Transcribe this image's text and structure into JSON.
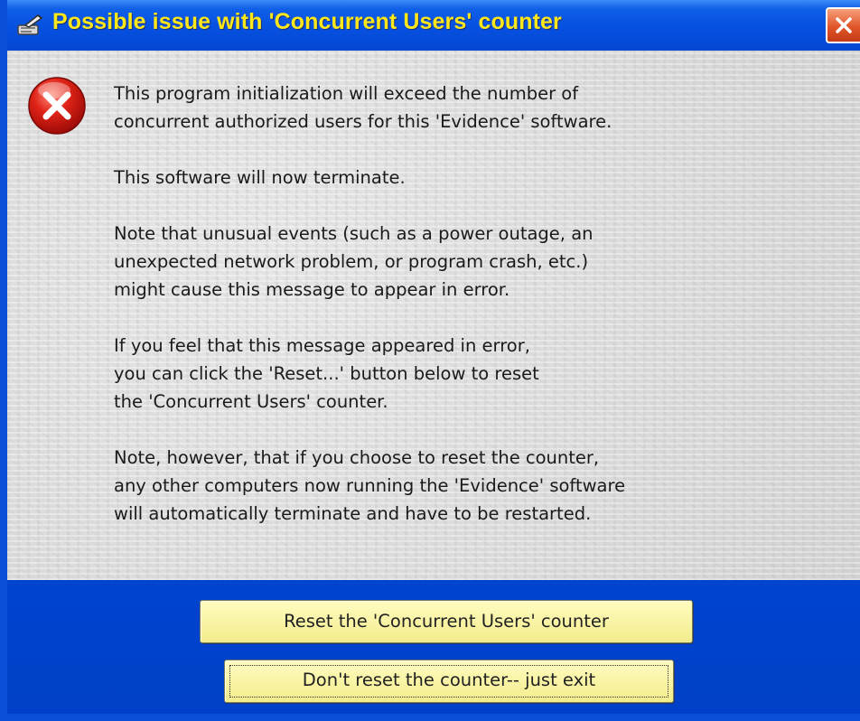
{
  "window": {
    "title": "Possible issue with 'Concurrent Users' counter",
    "title_icon": "gear-pen-icon",
    "close_icon": "close-icon"
  },
  "dialog": {
    "icon": "error-icon",
    "paragraphs": [
      "This program initialization will exceed the number of\nconcurrent authorized users for this 'Evidence' software.",
      "This software will now terminate.",
      "Note that unusual events (such as a power outage, an\nunexpected network problem, or program crash, etc.)\nmight cause this message to appear in error.",
      "If you feel that this message appeared in error,\nyou can click the 'Reset...' button below to reset\nthe 'Concurrent Users' counter.",
      "Note, however, that if you choose to reset the counter,\nany other computers now running the 'Evidence' software\nwill automatically terminate and have to be restarted."
    ]
  },
  "buttons": {
    "reset_label": "Reset the 'Concurrent Users' counter",
    "exit_label": "Don't reset the counter-- just exit"
  },
  "colors": {
    "titlebar": "#0650e0",
    "title_text": "#ffe81a",
    "button_face": "#f7f1a0",
    "close_button": "#e0552a",
    "error_red": "#d01010"
  }
}
